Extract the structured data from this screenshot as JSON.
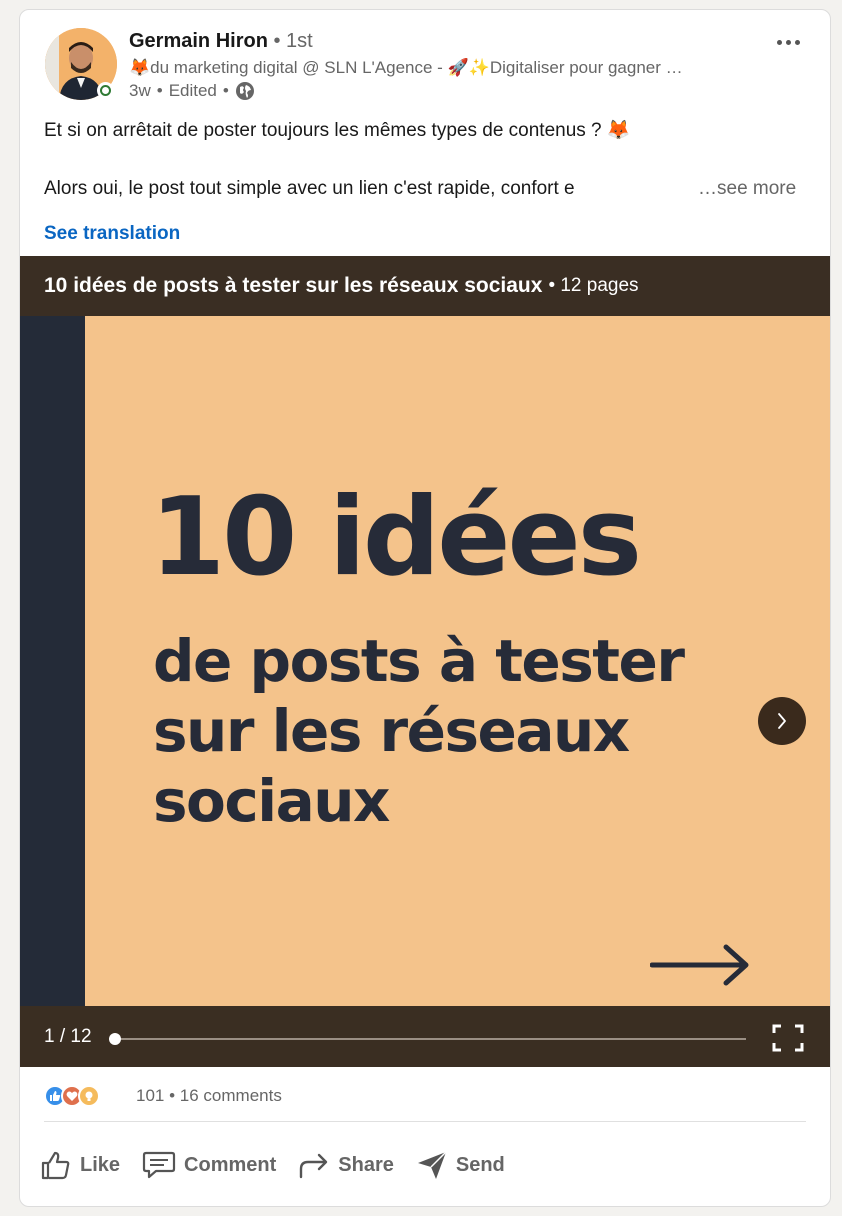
{
  "author": {
    "name": "Germain Hiron",
    "degree": "• 1st",
    "headline": "🦊du marketing digital @ SLN L'Agence - 🚀✨Digitaliser pour gagner …",
    "time": "3w",
    "edited": "Edited",
    "separator": "•"
  },
  "post": {
    "line1": "Et si on arrêtait de poster toujours les mêmes types de contenus ? 🦊",
    "line2": "Alors oui, le post tout simple avec un lien c'est rapide, confort e",
    "see_more": "…see more",
    "see_translation": "See translation"
  },
  "document": {
    "title": "10 idées de posts à tester sur les réseaux sociaux",
    "pages": "• 12 pages",
    "slide_line1": "10 idées",
    "slide_line2": "de posts à tester",
    "slide_line3": "sur les réseaux",
    "slide_line4": "sociaux",
    "page_counter": "1 / 12",
    "progress": 0.0
  },
  "social": {
    "reaction_count": "101",
    "comments": "• 16 comments",
    "reactions": [
      "like-icon",
      "love-icon",
      "insightful-icon"
    ]
  },
  "actions": {
    "like": "Like",
    "comment": "Comment",
    "share": "Share",
    "send": "Send"
  },
  "colors": {
    "slide_bg": "#f4c38b",
    "slide_text": "#262b38",
    "link_blue": "#0a66c2",
    "doc_bar": "#3a2e22"
  }
}
